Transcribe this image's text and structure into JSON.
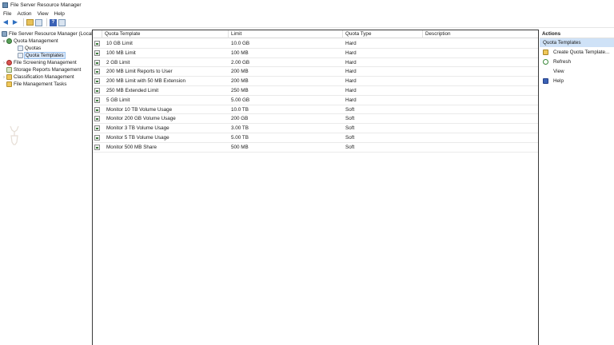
{
  "window": {
    "title": "File Server Resource Manager"
  },
  "menu": [
    "File",
    "Action",
    "View",
    "Help"
  ],
  "tree": {
    "root": "File Server Resource Manager (Local)",
    "quota_management": "Quota Management",
    "quotas": "Quotas",
    "quota_templates": "Quota Templates",
    "file_screening": "File Screening Management",
    "storage_reports": "Storage Reports Management",
    "classification": "Classification Management",
    "file_tasks": "File Management Tasks"
  },
  "table": {
    "columns": [
      "Quota Template",
      "Limit",
      "Quota Type",
      "Description"
    ],
    "rows": [
      [
        "10 GB Limit",
        "10.0 GB",
        "Hard",
        ""
      ],
      [
        "100 MB Limit",
        "100 MB",
        "Hard",
        ""
      ],
      [
        "2 GB Limit",
        "2.00 GB",
        "Hard",
        ""
      ],
      [
        "200 MB Limit Reports to User",
        "200 MB",
        "Hard",
        ""
      ],
      [
        "200 MB Limit with 50 MB Extension",
        "200 MB",
        "Hard",
        ""
      ],
      [
        "250 MB Extended Limit",
        "250 MB",
        "Hard",
        ""
      ],
      [
        "5 GB Limit",
        "5.00 GB",
        "Hard",
        ""
      ],
      [
        "Monitor 10 TB Volume Usage",
        "10.0 TB",
        "Soft",
        ""
      ],
      [
        "Monitor 200 GB Volume Usage",
        "200 GB",
        "Soft",
        ""
      ],
      [
        "Monitor 3 TB Volume Usage",
        "3.00 TB",
        "Soft",
        ""
      ],
      [
        "Monitor 5 TB Volume Usage",
        "5.00 TB",
        "Soft",
        ""
      ],
      [
        "Monitor 500 MB Share",
        "500 MB",
        "Soft",
        ""
      ]
    ]
  },
  "actions": {
    "header": "Actions",
    "section": "Quota Templates",
    "items": [
      {
        "label": "Create Quota Template...",
        "icon": "create-icon"
      },
      {
        "label": "Refresh",
        "icon": "refresh-icon"
      },
      {
        "label": "View",
        "icon": ""
      },
      {
        "label": "Help",
        "icon": "help-icon"
      }
    ]
  },
  "colors": {
    "selection": "#cfe2f7",
    "tree_selected": "#d9e8fb",
    "accent": "#3b62b5"
  }
}
